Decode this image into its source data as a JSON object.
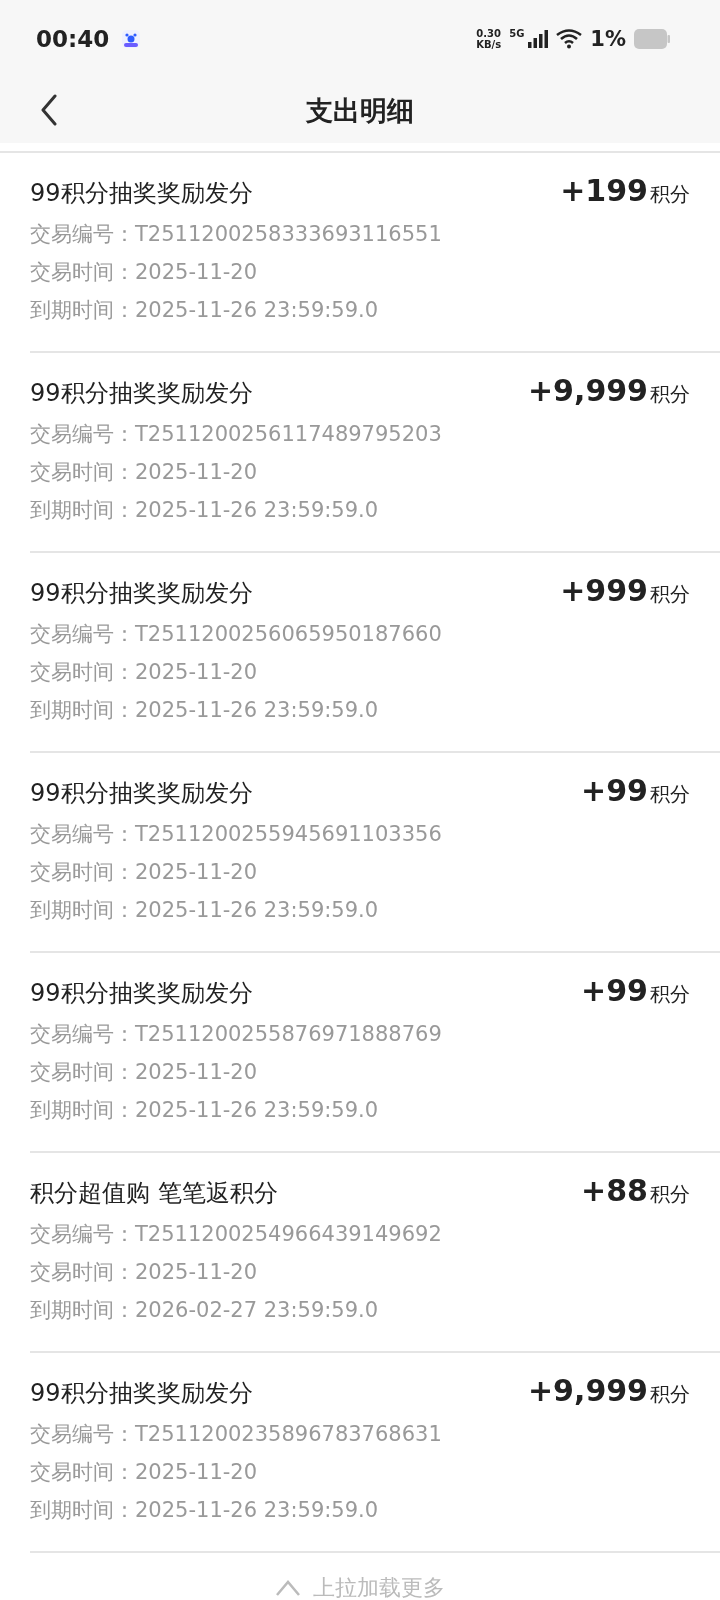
{
  "status_bar": {
    "time": "00:40",
    "speed_value": "0.30",
    "speed_unit": "KB/s",
    "network": "5G",
    "battery": "1%"
  },
  "nav": {
    "title": "支出明细"
  },
  "records": [
    {
      "title": "99积分抽奖奖励发分",
      "amount": "+199",
      "unit": "积分",
      "lines": [
        {
          "label": "交易编号：",
          "value": "T2511200258333693116551"
        },
        {
          "label": "交易时间：",
          "value": "2025-11-20"
        },
        {
          "label": "到期时间：",
          "value": "2025-11-26 23:59:59.0"
        }
      ]
    },
    {
      "title": "99积分抽奖奖励发分",
      "amount": "+9,999",
      "unit": "积分",
      "lines": [
        {
          "label": "交易编号：",
          "value": "T2511200256117489795203"
        },
        {
          "label": "交易时间：",
          "value": "2025-11-20"
        },
        {
          "label": "到期时间：",
          "value": "2025-11-26 23:59:59.0"
        }
      ]
    },
    {
      "title": "99积分抽奖奖励发分",
      "amount": "+999",
      "unit": "积分",
      "lines": [
        {
          "label": "交易编号：",
          "value": "T2511200256065950187660"
        },
        {
          "label": "交易时间：",
          "value": "2025-11-20"
        },
        {
          "label": "到期时间：",
          "value": "2025-11-26 23:59:59.0"
        }
      ]
    },
    {
      "title": "99积分抽奖奖励发分",
      "amount": "+99",
      "unit": "积分",
      "lines": [
        {
          "label": "交易编号：",
          "value": "T2511200255945691103356"
        },
        {
          "label": "交易时间：",
          "value": "2025-11-20"
        },
        {
          "label": "到期时间：",
          "value": "2025-11-26 23:59:59.0"
        }
      ]
    },
    {
      "title": "99积分抽奖奖励发分",
      "amount": "+99",
      "unit": "积分",
      "lines": [
        {
          "label": "交易编号：",
          "value": "T2511200255876971888769"
        },
        {
          "label": "交易时间：",
          "value": "2025-11-20"
        },
        {
          "label": "到期时间：",
          "value": "2025-11-26 23:59:59.0"
        }
      ]
    },
    {
      "title": "积分超值购 笔笔返积分",
      "amount": "+88",
      "unit": "积分",
      "lines": [
        {
          "label": "交易编号：",
          "value": "T2511200254966439149692"
        },
        {
          "label": "交易时间：",
          "value": "2025-11-20"
        },
        {
          "label": "到期时间：",
          "value": "2026-02-27 23:59:59.0"
        }
      ]
    },
    {
      "title": "99积分抽奖奖励发分",
      "amount": "+9,999",
      "unit": "积分",
      "lines": [
        {
          "label": "交易编号：",
          "value": "T2511200235896783768631"
        },
        {
          "label": "交易时间：",
          "value": "2025-11-20"
        },
        {
          "label": "到期时间：",
          "value": "2025-11-26 23:59:59.0"
        }
      ]
    }
  ],
  "footer": {
    "hint": "上拉加载更多"
  }
}
